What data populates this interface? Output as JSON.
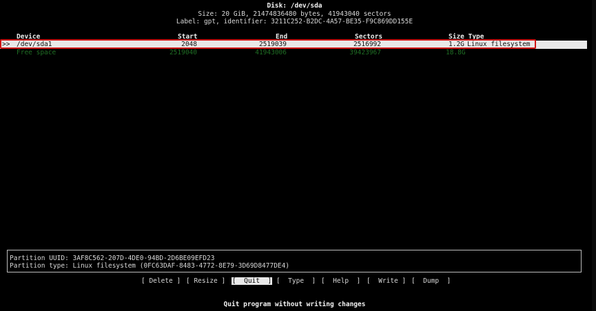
{
  "disk": {
    "title": "Disk: /dev/sda",
    "size_line": "Size: 20 GiB, 21474836480 bytes, 41943040 sectors",
    "label_line": "Label: gpt, identifier: 3211C252-B2DC-4A57-BE35-F9C869DD155E"
  },
  "table": {
    "headers": {
      "device": "Device",
      "start": "Start",
      "end": "End",
      "sectors": "Sectors",
      "size_type": "Size Type"
    },
    "rows": [
      {
        "marker": ">>",
        "device": "/dev/sda1",
        "start": "2048",
        "end": "2519039",
        "sectors": "2516992",
        "size": "1.2G",
        "type": "Linux filesystem"
      },
      {
        "device": "Free space",
        "start": "2519040",
        "end": "41943006",
        "sectors": "39423967",
        "size": "18.8G"
      }
    ]
  },
  "info": {
    "uuid_line": "Partition UUID: 3AF8C562-207D-4DE0-94BD-2D6BE09EFD23",
    "type_line": "Partition type: Linux filesystem (0FC63DAF-8483-4772-8E79-3D69D8477DE4)"
  },
  "buttons": {
    "delete": "[ Delete ]",
    "resize": "[ Resize ]",
    "quit": "[  Quit  ]",
    "type": "[  Type  ]",
    "help": "[  Help  ]",
    "write": "[  Write ]",
    "dump": "[  Dump  ]"
  },
  "status": {
    "hint": "Quit program without writing changes"
  },
  "colors": {
    "background": "#000000",
    "selection": "#e9e9e9",
    "highlight_border": "#d01515",
    "free_space": "#1f6e24"
  }
}
